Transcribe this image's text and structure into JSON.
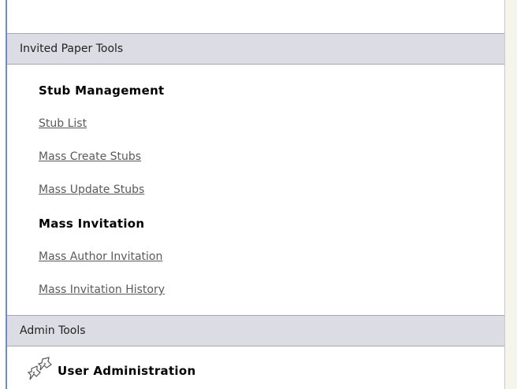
{
  "invited_tools": {
    "header": "Invited Paper Tools",
    "stub_management": {
      "title": "Stub Management",
      "links": [
        "Stub List",
        "Mass Create Stubs",
        "Mass Update Stubs"
      ]
    },
    "mass_invitation": {
      "title": "Mass Invitation",
      "links": [
        "Mass Author Invitation",
        "Mass Invitation History"
      ]
    }
  },
  "admin_tools": {
    "header": "Admin Tools",
    "user_admin": {
      "label": "User Administration",
      "icon": "pushpin-users-icon"
    }
  }
}
